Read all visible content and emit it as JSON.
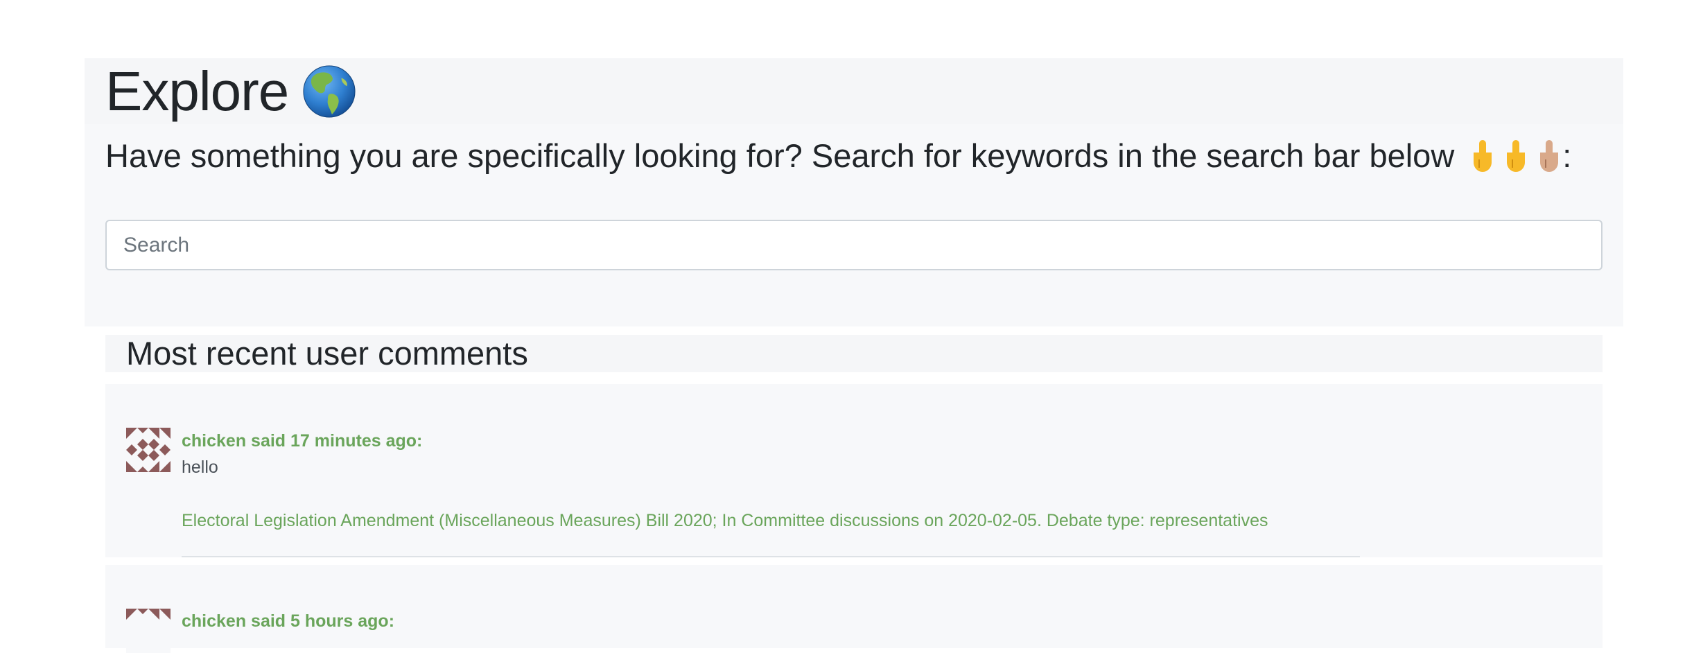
{
  "header": {
    "title": "Explore",
    "subtitle": "Have something you are specifically looking for? Search for keywords in the search bar below",
    "subtitle_suffix": ":"
  },
  "search": {
    "placeholder": "Search",
    "value": ""
  },
  "recent": {
    "title": "Most recent user comments",
    "comments": [
      {
        "author_line": "chicken said 17 minutes ago:",
        "body": "hello",
        "link": "Electoral Legislation Amendment (Miscellaneous Measures) Bill 2020; In Committee discussions on 2020-02-05. Debate type: representatives"
      },
      {
        "author_line": "chicken said 5 hours ago:",
        "body": "",
        "link": ""
      }
    ]
  },
  "colors": {
    "accent_green": "#6aa55b",
    "avatar_pattern": "#8c5a5a",
    "panel_bg": "#f7f8fa"
  },
  "icons": [
    "globe-americas-icon",
    "pointing-down-hand-icon",
    "identicon-avatar"
  ]
}
